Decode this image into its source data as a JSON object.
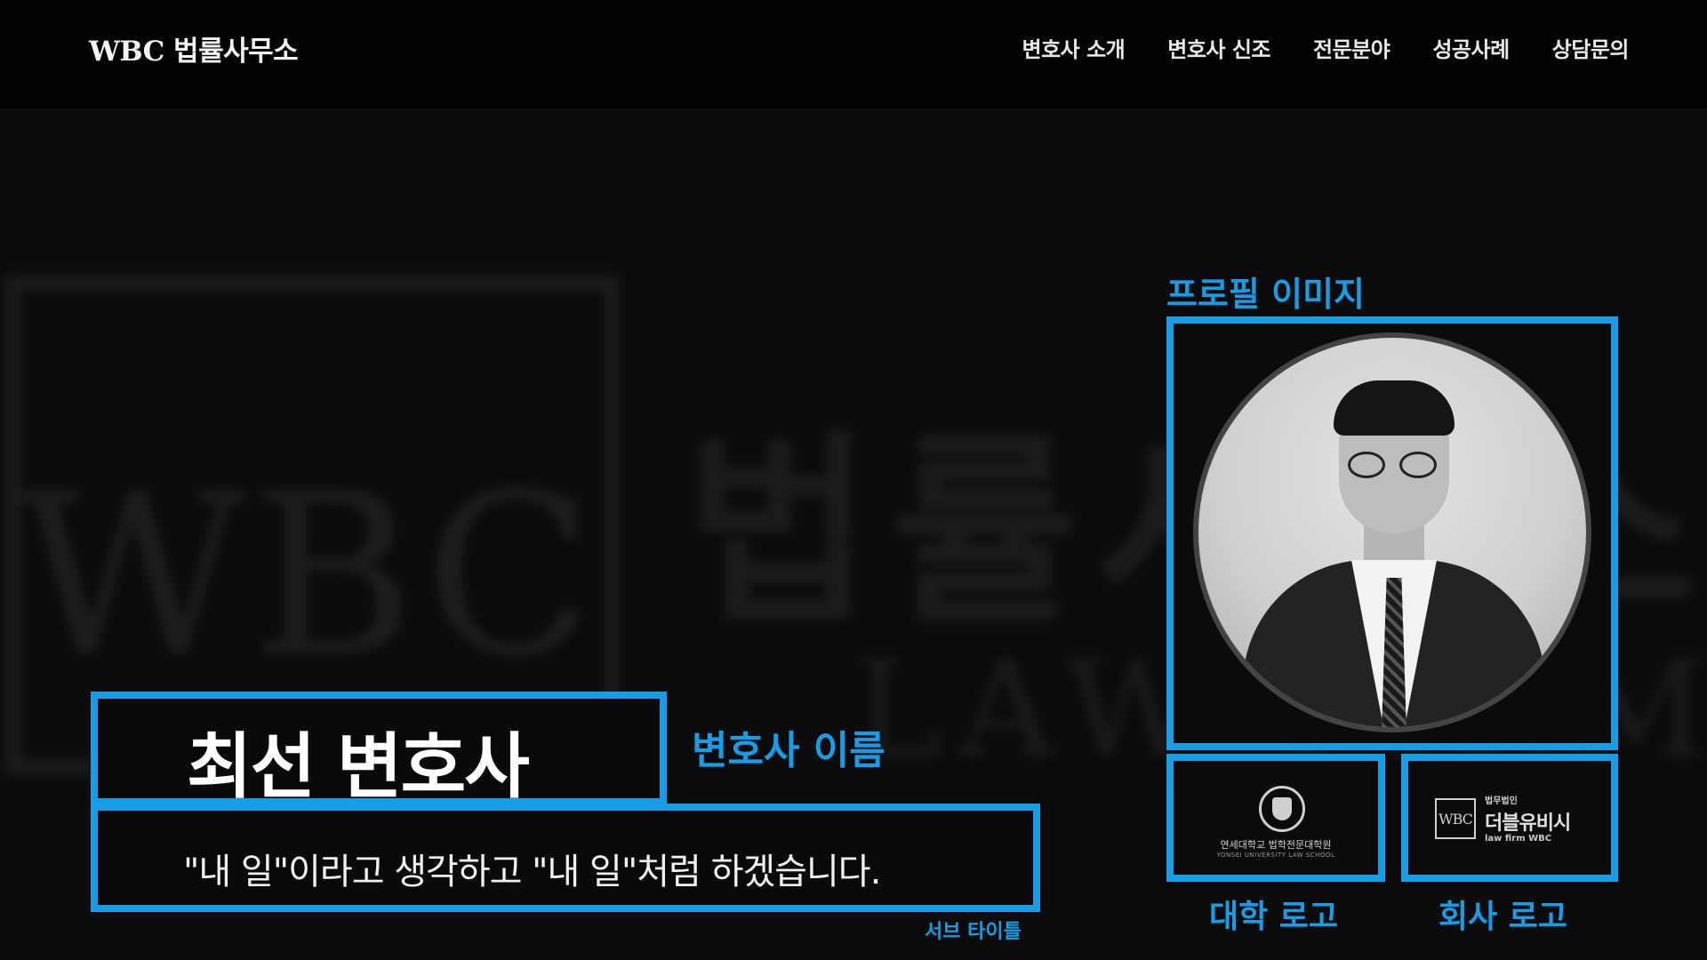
{
  "header": {
    "logo": "WBC 법률사무소",
    "nav": [
      "변호사 소개",
      "변호사 신조",
      "전문분야",
      "성공사례",
      "상담문의"
    ]
  },
  "watermark": {
    "wbc": "WBC",
    "korean": "법률사무소",
    "law": "LAW FIRM"
  },
  "hero": {
    "lawyer_name": "최선 변호사",
    "subtitle": "\"내 일\"이라고 생각하고 \"내 일\"처럼 하겠습니다."
  },
  "annotations": {
    "profile_image": "프로필 이미지",
    "lawyer_name": "변호사 이름",
    "subtitle": "서브 타이틀",
    "university_logo": "대학 로고",
    "company_logo": "회사 로고"
  },
  "university_logo": {
    "name": "연세대학교 법학전문대학원",
    "english": "YONSEI UNIVERSITY LAW SCHOOL"
  },
  "company_logo": {
    "mark": "WBC",
    "small": "법무법인",
    "name": "더블유비시",
    "english": "law firm WBC"
  },
  "colors": {
    "accent": "#169de5",
    "background": "#0c0c0d",
    "header": "#030303"
  }
}
